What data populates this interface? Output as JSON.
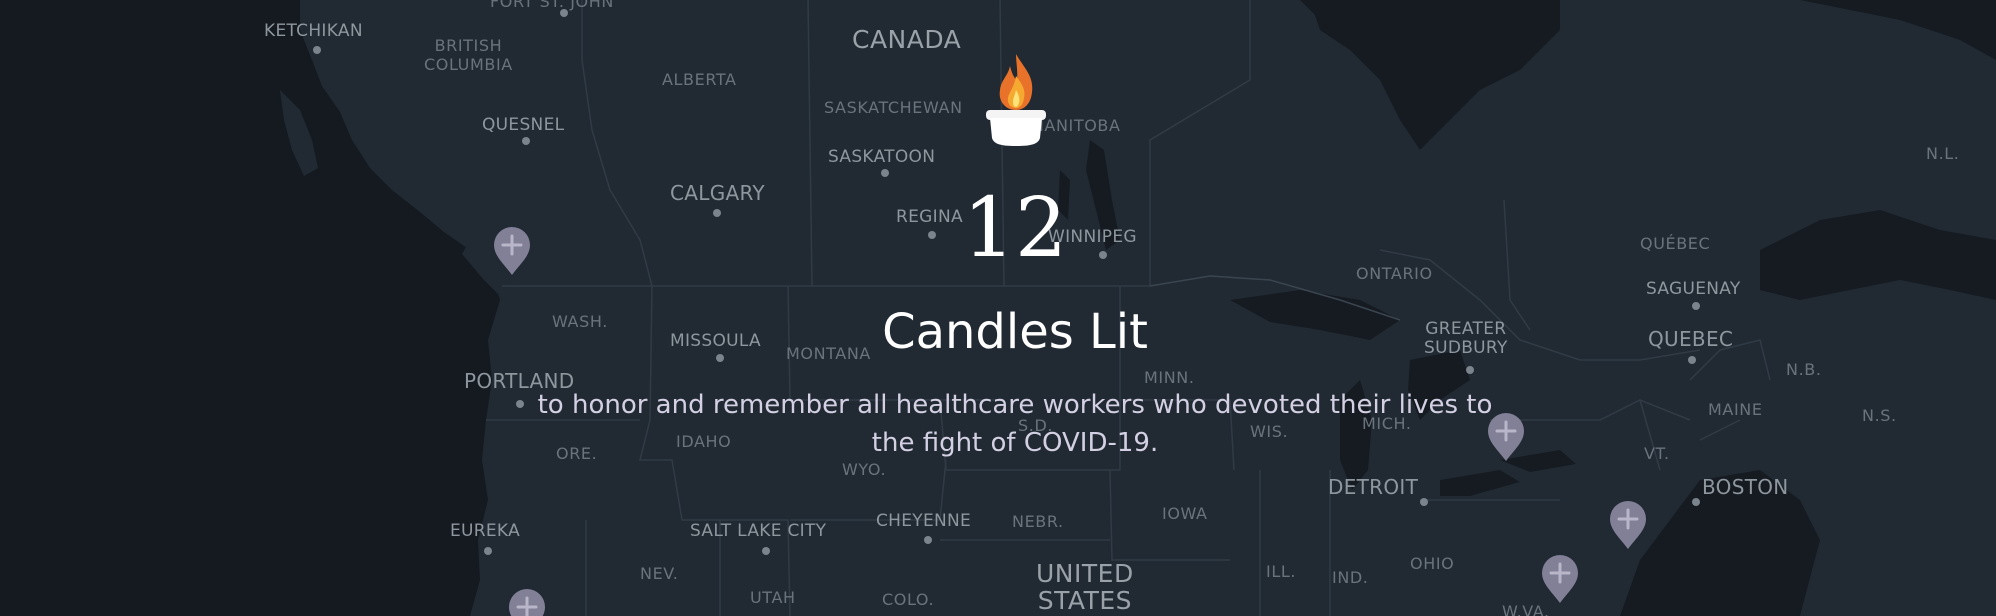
{
  "map": {
    "labels": {
      "ketchikan": "KETCHIKAN",
      "british_columbia": "BRITISH\nCOLUMBIA",
      "fort_st_john": "FORT ST. JOHN",
      "alberta": "ALBERTA",
      "canada": "CANADA",
      "saskatchewan": "SASKATCHEWAN",
      "manitoba": "MANITOBA",
      "quesnel": "QUESNEL",
      "saskatoon": "SASKATOON",
      "calgary": "CALGARY",
      "regina": "REGINA",
      "winnipeg": "WINNIPEG",
      "ontario": "ONTARIO",
      "quebec_province": "QUÉBEC",
      "saguenay": "SAGUENAY",
      "quebec_city": "QUEBEC",
      "greater_sudbury": "GREATER\nSUDBURY",
      "nl": "N.L.",
      "nb": "N.B.",
      "ns": "N.S.",
      "maine": "MAINE",
      "vt": "VT.",
      "boston": "BOSTON",
      "wash": "WASH.",
      "missoula": "MISSOULA",
      "montana": "MONTANA",
      "portland": "PORTLAND",
      "ore": "ORE.",
      "idaho": "IDAHO",
      "wyo": "WYO.",
      "sd": "S.D.",
      "minn": "MINN.",
      "wis": "WIS.",
      "mich": "MICH.",
      "detroit": "DETROIT",
      "iowa": "IOWA",
      "nebr": "NEBR.",
      "cheyenne": "CHEYENNE",
      "salt_lake_city": "SALT LAKE CITY",
      "eureka": "EUREKA",
      "nev": "NEV.",
      "utah": "UTAH",
      "colo": "COLO.",
      "united_states": "UNITED\nSTATES",
      "ill": "ILL.",
      "ind": "IND.",
      "ohio": "OHIO",
      "wva": "W.VA."
    },
    "pin_icon": "plus-icon",
    "colors": {
      "water": "#141a20",
      "land": "#212a33",
      "borders": "#313b45",
      "pin": "#8a889e"
    }
  },
  "memorial": {
    "candle_icon": "candle-icon",
    "count": "12",
    "heading": "Candles Lit",
    "subtitle_line1": "to honor and remember all healthcare workers who devoted their lives to",
    "subtitle_line2": "the fight of COVID-19."
  }
}
